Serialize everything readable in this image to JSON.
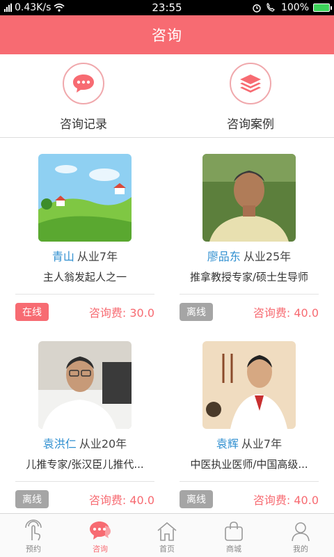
{
  "status": {
    "speed": "0.43K/s",
    "time": "23:55",
    "battery": "100%"
  },
  "header": {
    "title": "咨询"
  },
  "quick": [
    {
      "label": "咨询记录",
      "icon": "chat-bubble-icon"
    },
    {
      "label": "咨询案例",
      "icon": "layers-icon"
    }
  ],
  "consultants": [
    {
      "name": "青山",
      "years": "从业7年",
      "desc": "主人翁发起人之一",
      "status": "在线",
      "fee": "咨询费: 30.0",
      "online": true
    },
    {
      "name": "廖品东",
      "years": "从业25年",
      "desc": "推拿教授专家/硕士生导师",
      "status": "离线",
      "fee": "咨询费: 40.0",
      "online": false
    },
    {
      "name": "袁洪仁",
      "years": "从业20年",
      "desc": "儿推专家/张汉臣儿推代...",
      "status": "离线",
      "fee": "咨询费: 40.0",
      "online": false
    },
    {
      "name": "袁辉",
      "years": "从业7年",
      "desc": "中医执业医师/中国高级...",
      "status": "离线",
      "fee": "咨询费: 40.0",
      "online": false
    }
  ],
  "tabs": [
    {
      "label": "预约",
      "icon": "touch-icon"
    },
    {
      "label": "咨询",
      "icon": "chat-icon"
    },
    {
      "label": "首页",
      "icon": "home-icon"
    },
    {
      "label": "商城",
      "icon": "shopping-bag-icon"
    },
    {
      "label": "我的",
      "icon": "user-icon"
    }
  ],
  "colors": {
    "accent": "#f76b72",
    "link": "#2f8fd0",
    "offline": "#a5a5a5"
  }
}
